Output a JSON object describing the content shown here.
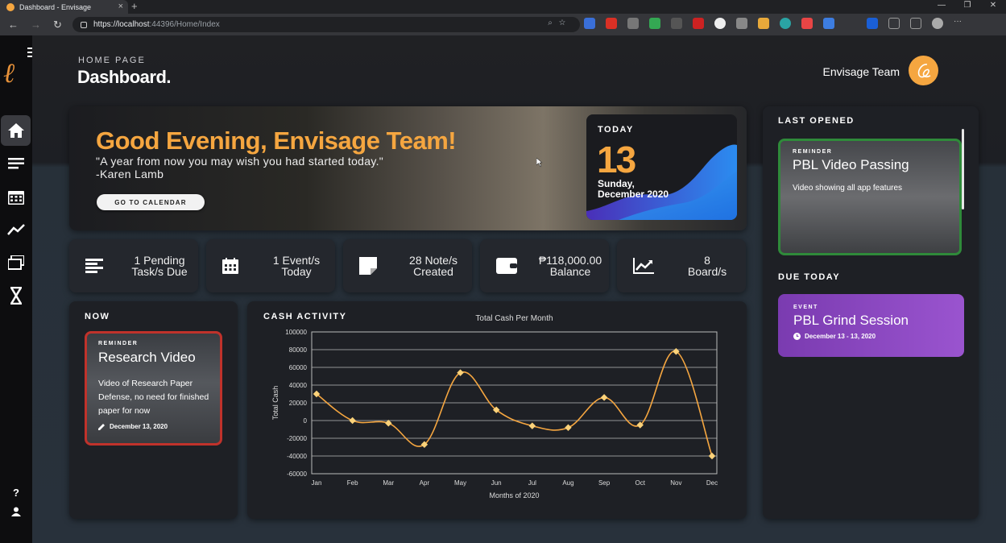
{
  "browser": {
    "tab_title": "Dashboard - Envisage",
    "url_main": "https://localhost",
    "url_rest": ":44396/Home/Index"
  },
  "header": {
    "breadcrumb": "HOME PAGE",
    "title": "Dashboard.",
    "team_name": "Envisage Team"
  },
  "hero": {
    "greeting": "Good Evening, Envisage Team!",
    "quote": "\"A year from now you may wish you had started today.\"",
    "author": "-Karen Lamb",
    "button": "GO TO CALENDAR",
    "today_label": "TODAY",
    "day": "13",
    "weekday": "Sunday,",
    "month_year": "December 2020"
  },
  "stats": [
    {
      "line1": "1 Pending",
      "line2": "Task/s Due",
      "icon": "list-icon"
    },
    {
      "line1": "1 Event/s",
      "line2": "Today",
      "icon": "calendar-icon"
    },
    {
      "line1": "28 Note/s",
      "line2": "Created",
      "icon": "note-icon"
    },
    {
      "line1": "₱118,000.00",
      "line2": "Balance",
      "icon": "wallet-icon"
    },
    {
      "line1": "8",
      "line2": "Board/s",
      "icon": "chart-icon"
    }
  ],
  "now": {
    "label": "NOW",
    "kind": "REMINDER",
    "title": "Research Video",
    "desc": "Video of Research Paper Defense, no need for finished paper for now",
    "date": "December 13, 2020"
  },
  "cash": {
    "label": "CASH ACTIVITY"
  },
  "last_opened": {
    "label": "LAST OPENED",
    "kind": "REMINDER",
    "title": "PBL Video Passing",
    "desc": "Video showing all app features"
  },
  "due_today": {
    "label": "DUE TODAY",
    "kind": "EVENT",
    "title": "PBL Grind Session",
    "date": "December 13 - 13, 2020"
  },
  "chart_data": {
    "type": "line",
    "title": "Total Cash Per Month",
    "xlabel": "Months of 2020",
    "ylabel": "Total Cash",
    "categories": [
      "Jan",
      "Feb",
      "Mar",
      "Apr",
      "May",
      "Jun",
      "Jul",
      "Aug",
      "Sep",
      "Oct",
      "Nov",
      "Dec"
    ],
    "values": [
      30000,
      0,
      -3000,
      -27000,
      54000,
      12000,
      -6000,
      -8000,
      26000,
      -5000,
      78000,
      -40000
    ],
    "ylim": [
      -60000,
      100000
    ],
    "yticks": [
      100000,
      80000,
      60000,
      40000,
      20000,
      0,
      -20000,
      -40000,
      -60000
    ],
    "grid": true,
    "color": "#f5a640"
  }
}
